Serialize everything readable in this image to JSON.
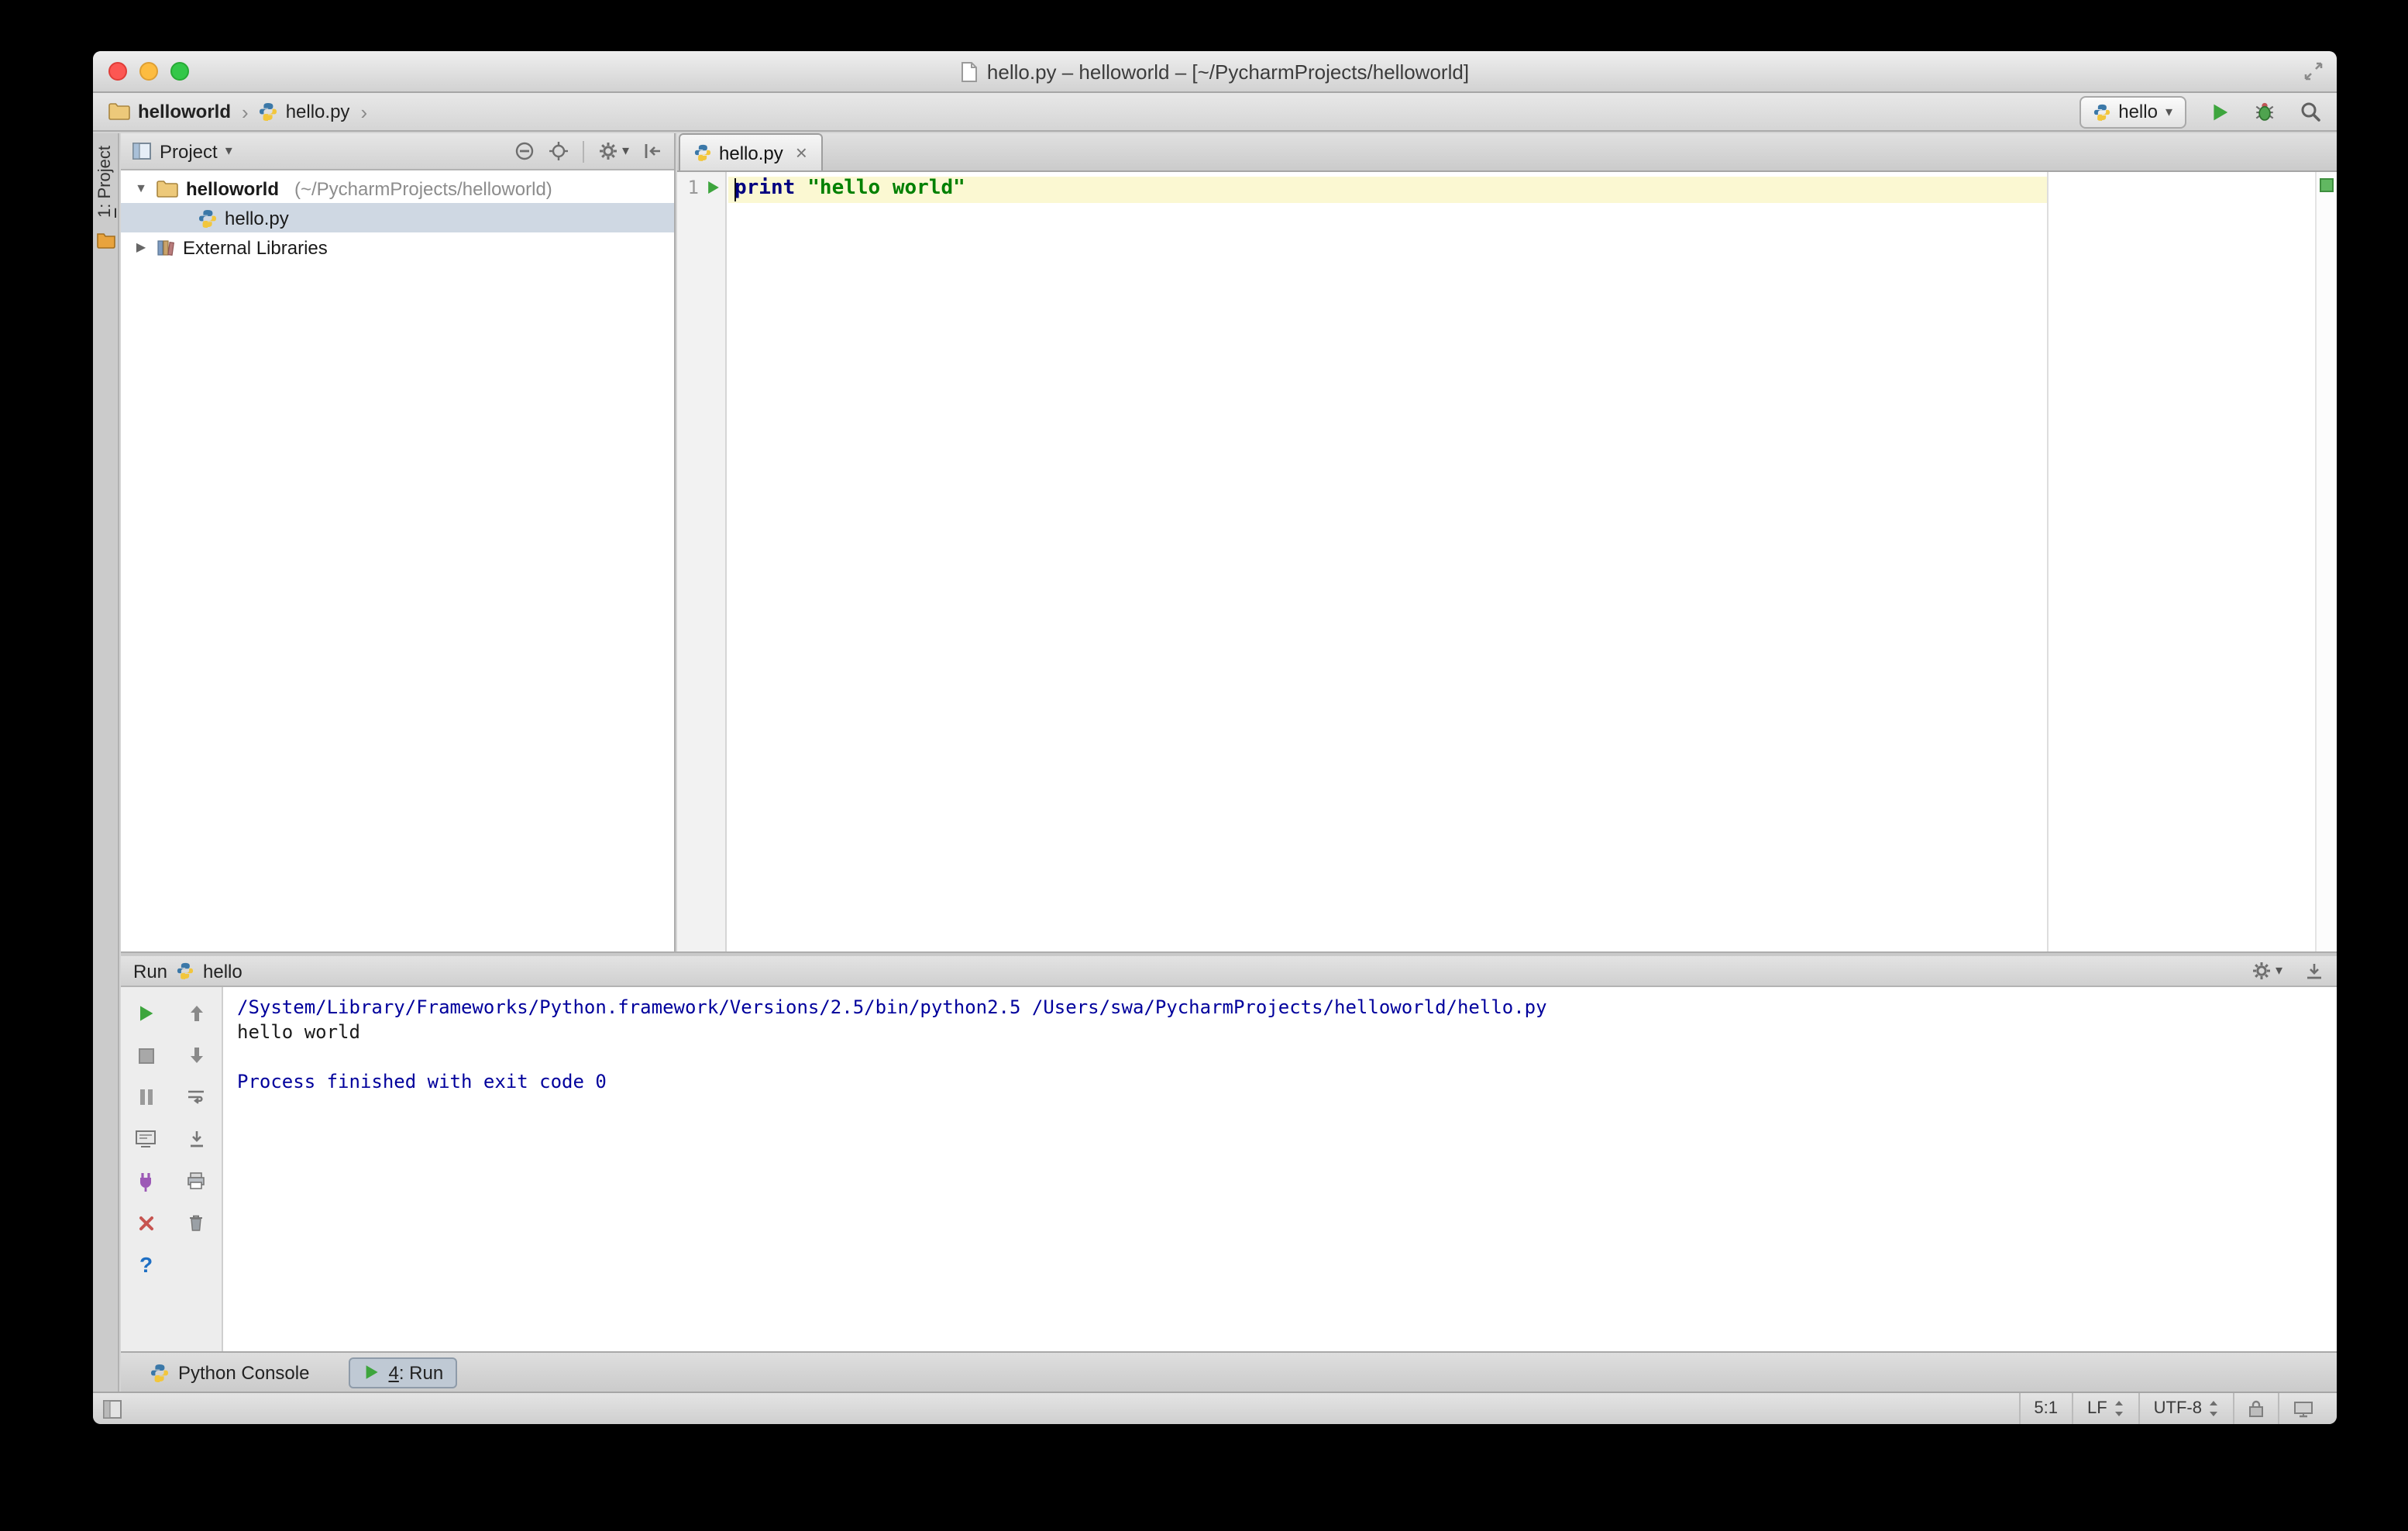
{
  "window": {
    "title": "hello.py – helloworld – [~/PycharmProjects/helloworld]"
  },
  "glyphs": {
    "chevron": "›",
    "combo_arrow": "▾",
    "disclosure_open": "▼",
    "disclosure_closed": "▶",
    "tab_close": "×",
    "help": "?"
  },
  "navbar": {
    "breadcrumb": [
      {
        "label": "helloworld"
      },
      {
        "label": "hello.py"
      }
    ],
    "run_config": {
      "label": "hello"
    }
  },
  "tool_strip": {
    "project_button": {
      "key": "1",
      "label": ": Project"
    }
  },
  "project_panel": {
    "header": {
      "title": "Project"
    },
    "tree": {
      "root": {
        "name": "helloworld",
        "path": "(~/PycharmProjects/helloworld)"
      },
      "file": {
        "name": "hello.py"
      },
      "libraries": {
        "name": "External Libraries"
      }
    }
  },
  "editor": {
    "tab": {
      "label": "hello.py"
    },
    "line_number": "1",
    "code": {
      "keyword": "print",
      "string": "\"hello world\""
    }
  },
  "run_panel": {
    "header": {
      "title": "Run",
      "config": "hello"
    },
    "console": {
      "lines": [
        {
          "kind": "system",
          "text": "/System/Library/Frameworks/Python.framework/Versions/2.5/bin/python2.5 /Users/swa/PycharmProjects/helloworld/hello.py"
        },
        {
          "kind": "stdout",
          "text": "hello world"
        },
        {
          "kind": "stdout",
          "text": ""
        },
        {
          "kind": "system",
          "text": "Process finished with exit code 0"
        }
      ]
    }
  },
  "toolwindow_bar": {
    "python_console": {
      "label": "Python Console"
    },
    "run_tab": {
      "key": "4",
      "label": ": Run"
    }
  },
  "status_bar": {
    "caret_position": "5:1",
    "line_separator": "LF",
    "encoding": "UTF-8"
  },
  "colors": {
    "keyword": "#000080",
    "string": "#008000",
    "console_system": "#00009C",
    "run_green": "#3DA53D",
    "current_line": "#FBF8D2",
    "tree_selection": "#CFD8E3",
    "inspection_ok": "#61B861"
  }
}
